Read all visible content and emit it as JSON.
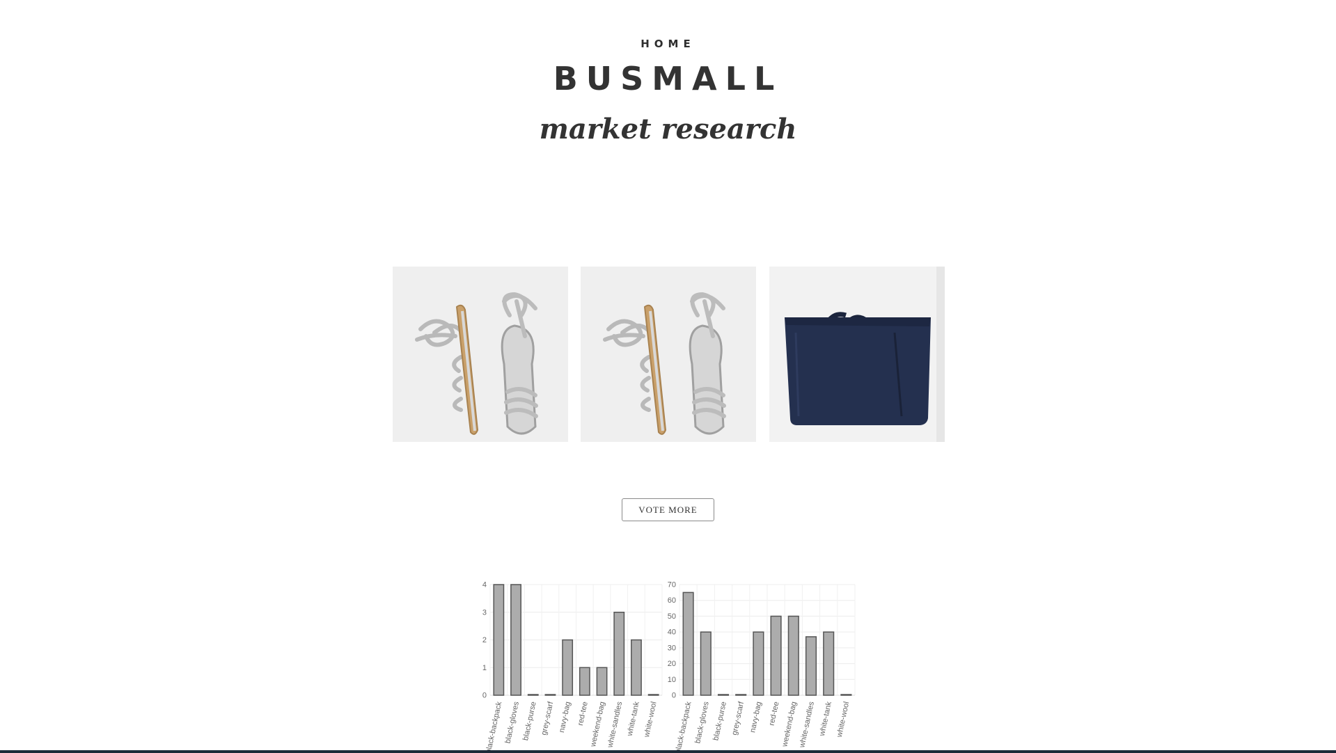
{
  "header": {
    "nav_home": "HOME",
    "title": "BUSMALL",
    "subtitle": "market research"
  },
  "products": [
    {
      "icon": "sandals-image"
    },
    {
      "icon": "sandals-image"
    },
    {
      "icon": "bag-image"
    }
  ],
  "actions": {
    "vote_more_label": "VOTE MORE"
  },
  "colors": {
    "text": "#333333",
    "bar_fill": "#acacac",
    "bar_stroke": "#555555",
    "bag_navy": "#24304f",
    "sandal_sole": "#c9a06a"
  },
  "chart_data": [
    {
      "type": "bar",
      "categories": [
        "black-backpack",
        "black-gloves",
        "black-purse",
        "grey-scarf",
        "navy-bag",
        "red-tee",
        "weekend-bag",
        "white-sandles",
        "white-tank",
        "white-wool"
      ],
      "values": [
        4,
        4,
        0,
        0,
        2,
        1,
        1,
        3,
        2,
        0
      ],
      "ylim": [
        0,
        4
      ],
      "yticks": [
        0,
        1,
        2,
        3,
        4
      ],
      "grid": true
    },
    {
      "type": "bar",
      "categories": [
        "black-backpack",
        "black-gloves",
        "black-purse",
        "grey-scarf",
        "navy-bag",
        "red-tee",
        "weekend-bag",
        "white-sandles",
        "white-tank",
        "white-wool"
      ],
      "values": [
        65,
        40,
        0,
        0,
        40,
        50,
        50,
        37,
        40,
        0
      ],
      "ylim": [
        0,
        70
      ],
      "yticks": [
        0,
        10,
        20,
        30,
        40,
        50,
        60,
        70
      ],
      "grid": true
    }
  ]
}
